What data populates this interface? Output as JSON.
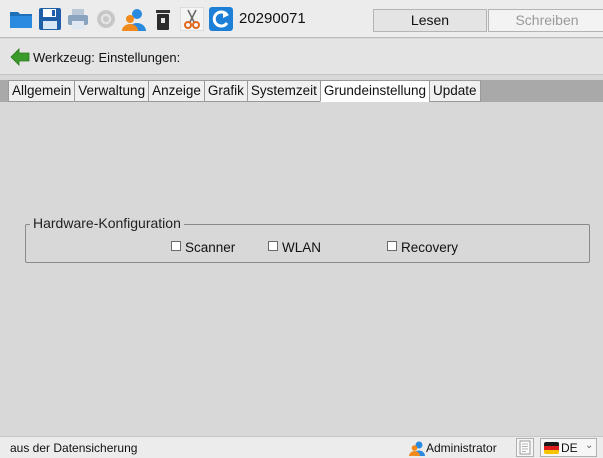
{
  "toolbar": {
    "record_id": "20290071",
    "read_label": "Lesen",
    "write_label": "Schreiben",
    "icons": [
      "folder-icon",
      "save-icon",
      "print-icon",
      "gear-icon",
      "users-icon",
      "trash-icon",
      "scissors-icon",
      "refresh-icon"
    ]
  },
  "path": {
    "label": "Werkzeug: Einstellungen:"
  },
  "tabs": [
    {
      "label": "Allgemein",
      "active": false
    },
    {
      "label": "Verwaltung",
      "active": false
    },
    {
      "label": "Anzeige",
      "active": false
    },
    {
      "label": "Grafik",
      "active": false
    },
    {
      "label": "Systemzeit",
      "active": false
    },
    {
      "label": "Grundeinstellung",
      "active": true
    },
    {
      "label": "Update",
      "active": false
    }
  ],
  "hardware": {
    "title": "Hardware-Konfiguration",
    "options": [
      {
        "label": "Scanner",
        "checked": false
      },
      {
        "label": "WLAN",
        "checked": false
      },
      {
        "label": "Recovery",
        "checked": false
      }
    ]
  },
  "status": {
    "message": "aus der Datensicherung",
    "user": "Administrator",
    "language": "DE"
  },
  "colors": {
    "accent_blue": "#1e7fd6",
    "back_green": "#3a9a2a",
    "background": "#d8d8d8"
  }
}
